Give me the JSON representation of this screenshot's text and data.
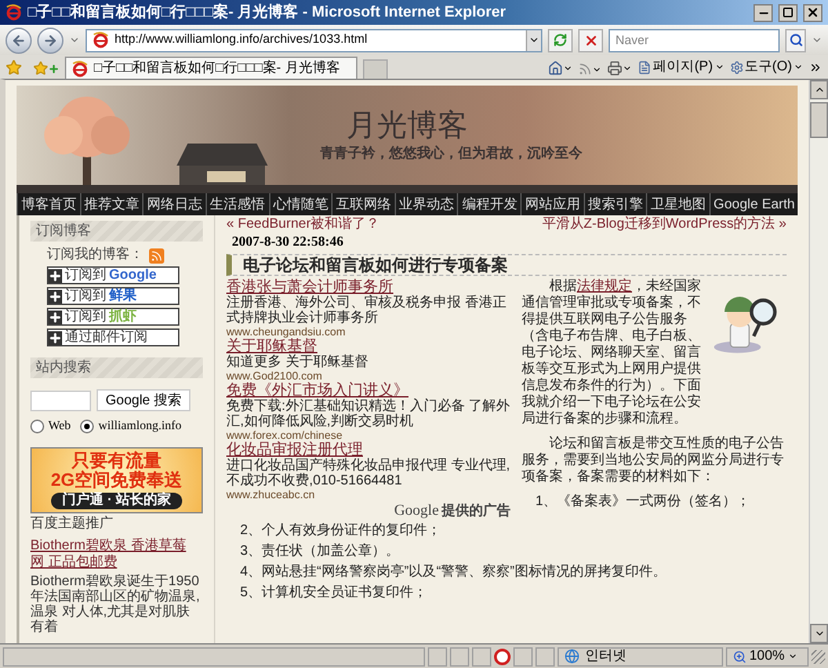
{
  "window": {
    "title": "□子□□和留言板如何□行□□□案- 月光博客 - Microsoft Internet Explorer"
  },
  "address_bar": {
    "url": "http://www.williamlong.info/archives/1033.html"
  },
  "search": {
    "placeholder": "Naver"
  },
  "tabs": [
    {
      "label": "□子□□和留言板如何□行□□□案- 月光博客",
      "selected": true
    }
  ],
  "command_bar": {
    "page": "페이지(P)",
    "tools": "도구(O)"
  },
  "blog_header": {
    "title": "月光博客",
    "subtitle": "青青子衿，悠悠我心，但为君故，沉吟至今"
  },
  "nav": [
    "博客首页",
    "推荐文章",
    "网络日志",
    "生活感悟",
    "心情随笔",
    "互联网络",
    "业界动态",
    "编程开发",
    "网站应用",
    "搜索引擎",
    "卫星地图",
    "Google Earth"
  ],
  "sidebar": {
    "subscribe": {
      "heading": "订阅博客",
      "label": "订阅我的博客：",
      "buttons": [
        {
          "prefix": "订阅到",
          "service": "Google",
          "color": "#3366cc"
        },
        {
          "prefix": "订阅到",
          "service": "鲜果",
          "color": "#1f5fc8"
        },
        {
          "prefix": "订阅到",
          "service": "抓虾",
          "color": "#7cb342"
        },
        {
          "prefix": "通过邮件订阅"
        }
      ]
    },
    "site_search": {
      "heading": "站内搜索",
      "button": "Google 搜索",
      "options": [
        {
          "label": "Web",
          "selected": false
        },
        {
          "label": "williamlong.info",
          "selected": true
        }
      ]
    },
    "banner_ad": {
      "lines": [
        "只要有流量",
        "2G空间免费奉送"
      ],
      "tagline": "门户通 · 站长的家"
    },
    "promo": {
      "heading": "百度主题推广",
      "title": "Biotherm碧欧泉 香港草莓网 正品包邮费",
      "text": "Biotherm碧欧泉诞生于1950年法国南部山区的矿物温泉,温泉 对人体,尤其是对肌肤有着"
    }
  },
  "post": {
    "prev": "« FeedBurner被和谐了？",
    "next": "平滑从Z-Blog迁移到WordPress的方法 »",
    "date": "2007-8-30 22:58:46",
    "title": "电子论坛和留言板如何进行专项备案",
    "ads": [
      {
        "title": "香港张与萧会计师事务所",
        "text": "注册香港、海外公司、审核及税务申报 香港正式持牌执业会计师事务所",
        "url": "www.cheungandsiu.com"
      },
      {
        "title": "关于耶稣基督",
        "text": "知道更多 关于耶稣基督",
        "url": "www.God2100.com"
      },
      {
        "title": "免费《外汇市场入门讲义》",
        "text": "免费下载:外汇基础知识精选！入门必备 了解外汇,如何降低风险,判断交易时机",
        "url": "www.forex.com/chinese"
      },
      {
        "title": "化妆品审报注册代理",
        "text": "进口化妆品国产特殊化妆品申报代理 专业代理,不成功不收费,010-51664481",
        "url": "www.zhuceabc.cn"
      }
    ],
    "ads_brand": "Google",
    "ads_label": "提供的广告",
    "intro": {
      "before": "根据",
      "link": "法律规定",
      "after": "，未经国家通信管理审批或专项备案，不得提供互联网电子公告服务（含电子布告牌、电子白板、电子论坛、网络聊天室、留言板等交互形式为上网用户提供信息发布条件的行为）。下面我就介绍一下电子论坛在公安局进行备案的步骤和流程。"
    },
    "paragraph": "论坛和留言板是带交互性质的电子公告服务，需要到当地公安局的网监分局进行专项备案，备案需要的材料如下：",
    "items": [
      "1、《备案表》一式两份（签名）；",
      "2、个人有效身份证件的复印件；",
      "3、责任状（加盖公章）。",
      "4、网站悬挂“网络警察岗亭”以及“警警、察察”图标情况的屏拷复印件。",
      "5、计算机安全员证书复印件；"
    ]
  },
  "status_bar": {
    "zone": "인터넷",
    "zoom": "100%"
  }
}
